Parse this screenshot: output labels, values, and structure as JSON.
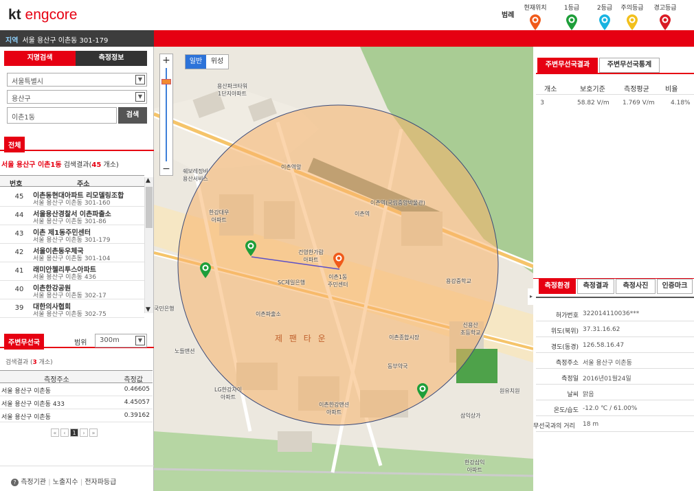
{
  "header": {
    "logo_kt": "kt",
    "logo_engcore": "engcore",
    "legend_label": "범례",
    "legend_items": [
      {
        "label": "현재위치",
        "color": "#f05a1a",
        "icon": "current-location-pin-icon"
      },
      {
        "label": "1등급",
        "color": "#1e9e3a",
        "icon": "grade1-pin-icon"
      },
      {
        "label": "2등급",
        "color": "#19b3e0",
        "icon": "grade2-pin-icon"
      },
      {
        "label": "주의등급",
        "color": "#f2c01c",
        "icon": "caution-pin-icon"
      },
      {
        "label": "경고등급",
        "color": "#d81b24",
        "icon": "warning-pin-icon"
      }
    ]
  },
  "region": {
    "label": "지역",
    "value": "서울 용산구 이촌동 301-179"
  },
  "left": {
    "tabs": {
      "place_search": "지명검색",
      "measure_info": "측정정보"
    },
    "select_city": "서울특별시",
    "select_gu": "용산구",
    "dong_input": "이촌1동",
    "search_button": "검색",
    "all_label": "전체",
    "result_prefix": "서울 용산구 이촌1동",
    "result_mid": " 검색결과(",
    "result_count": "45",
    "result_suffix": " 개소)",
    "col_num": "번호",
    "col_addr": "주소",
    "results": [
      {
        "n": "45",
        "title": "이촌동현대아파트 리모델링조합",
        "addr": "서울 용산구 이촌동 301-160"
      },
      {
        "n": "44",
        "title": "서울용산경찰서 이촌파출소",
        "addr": "서울 용산구 이촌동 301-86"
      },
      {
        "n": "43",
        "title": "이촌 제1동주민센터",
        "addr": "서울 용산구 이촌동 301-179"
      },
      {
        "n": "42",
        "title": "서울이촌동우체국",
        "addr": "서울 용산구 이촌동 301-104"
      },
      {
        "n": "41",
        "title": "래미안첼리투스아파트",
        "addr": "서울 용산구 이촌동 436"
      },
      {
        "n": "40",
        "title": "이촌한강공원",
        "addr": "서울 용산구 이촌동 302-17"
      },
      {
        "n": "39",
        "title": "대한의사협회",
        "addr": "서울 용산구 이촌동 302-75"
      }
    ],
    "nearby_label": "주변무선국",
    "range_label": "범위",
    "range_value": "300m",
    "nearby_count_prefix": "검색결과 (",
    "nearby_count": "3",
    "nearby_count_suffix": " 개소)",
    "nearby_col_addr": "측정주소",
    "nearby_col_val": "측정값",
    "nearby_rows": [
      {
        "addr": "서울 용산구 이촌동",
        "val": "0.46605"
      },
      {
        "addr": "서울 용산구 이촌동 433",
        "val": "4.45057"
      },
      {
        "addr": "서울 용산구 이촌동",
        "val": "0.39162"
      }
    ],
    "pager": [
      "«",
      "‹",
      "1",
      "›",
      "»"
    ],
    "footer": [
      "측정기관",
      "노출지수",
      "전자파등급"
    ]
  },
  "map": {
    "btn_normal": "일반",
    "btn_satellite": "위성",
    "zoom_in": "+",
    "zoom_out": "−",
    "labels": [
      {
        "t": "용산파크타워\n1단지아파트",
        "k": "l1"
      },
      {
        "t": "이촌역앞",
        "k": "l2"
      },
      {
        "t": "쉐보레정비\n용산서비스",
        "k": "l3"
      },
      {
        "t": "한강대우\n아파트",
        "k": "l4"
      },
      {
        "t": "건영한가람\n아파트",
        "k": "l5"
      },
      {
        "t": "이촌1동\n주민센터",
        "k": "l6"
      },
      {
        "t": "SC제일은행",
        "k": "l7"
      },
      {
        "t": "이촌파출소",
        "k": "l8"
      },
      {
        "t": "용강중학교",
        "k": "l9"
      },
      {
        "t": "이촌종합시장",
        "k": "l10"
      },
      {
        "t": "신용산\n초등학교",
        "k": "l11"
      },
      {
        "t": "제 팬 타 운",
        "k": "l12"
      },
      {
        "t": "동부약국",
        "k": "l13"
      },
      {
        "t": "국민은행",
        "k": "l14"
      },
      {
        "t": "노들맨션",
        "k": "l15"
      },
      {
        "t": "LG한강자이\n아파트",
        "k": "l16"
      },
      {
        "t": "이촌한강맨션\n아파트",
        "k": "l17"
      },
      {
        "t": "삼익상가",
        "k": "l18"
      },
      {
        "t": "한강삼익\n아파트",
        "k": "l19"
      },
      {
        "t": "원유치원",
        "k": "l20"
      },
      {
        "t": "이촌역(국립중앙박물관)",
        "k": "l21"
      },
      {
        "t": "이촌역",
        "k": "l22"
      }
    ]
  },
  "right": {
    "tabs_top": [
      "주변무선국결과",
      "주변무선국통계"
    ],
    "stats_headers": [
      "개소",
      "보호기준",
      "측정평균",
      "비율"
    ],
    "stats_row": [
      "3",
      "58.82 V/m",
      "1.769 V/m",
      "4.18%"
    ],
    "tabs_bottom": [
      "측정환경",
      "측정결과",
      "측정사진",
      "인증마크"
    ],
    "fields": [
      {
        "k": "허가번호",
        "v": "322014110036***"
      },
      {
        "k": "위도(북위)",
        "v": "37.31.16.62"
      },
      {
        "k": "경도(동경)",
        "v": "126.58.16.47"
      },
      {
        "k": "측정주소",
        "v": "서울 용산구 이촌동"
      },
      {
        "k": "측정일",
        "v": "2016년01월24일"
      },
      {
        "k": "날씨",
        "v": "맑음"
      },
      {
        "k": "온도/습도",
        "v": "-12.0 ℃ / 61.00%"
      },
      {
        "k": "무선국과의 거리",
        "v": "18 m"
      }
    ]
  }
}
